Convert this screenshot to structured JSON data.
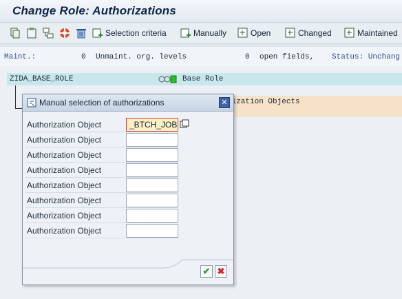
{
  "window": {
    "title": "Change Role: Authorizations"
  },
  "toolbar": {
    "buttons": [
      {
        "label": "Selection criteria"
      },
      {
        "label": "Manually"
      },
      {
        "label": "Open"
      },
      {
        "label": "Changed"
      },
      {
        "label": "Maintained"
      }
    ]
  },
  "status_line": {
    "maint_label": "Maint.:",
    "maint_count": "0",
    "unmaint_label": "Unmaint. org. levels",
    "open_count": "0",
    "open_label": "open fields,",
    "status_label": "Status: Unchang"
  },
  "tree": {
    "role_name": "ZIDA_BASE_ROLE",
    "role_desc": "Base Role",
    "orange_text": "rization Objects"
  },
  "dialog": {
    "title": "Manual selection of authorizations",
    "rows": [
      {
        "label": "Authorization Object",
        "value": "_BTCH_JOB"
      },
      {
        "label": "Authorization Object",
        "value": ""
      },
      {
        "label": "Authorization Object",
        "value": ""
      },
      {
        "label": "Authorization Object",
        "value": ""
      },
      {
        "label": "Authorization Object",
        "value": ""
      },
      {
        "label": "Authorization Object",
        "value": ""
      },
      {
        "label": "Authorization Object",
        "value": ""
      },
      {
        "label": "Authorization Object",
        "value": ""
      }
    ]
  },
  "colors": {
    "role_row": "#c8e7ea",
    "highlight_row": "#f6e2c9",
    "active_field": "#fdf1c4"
  }
}
